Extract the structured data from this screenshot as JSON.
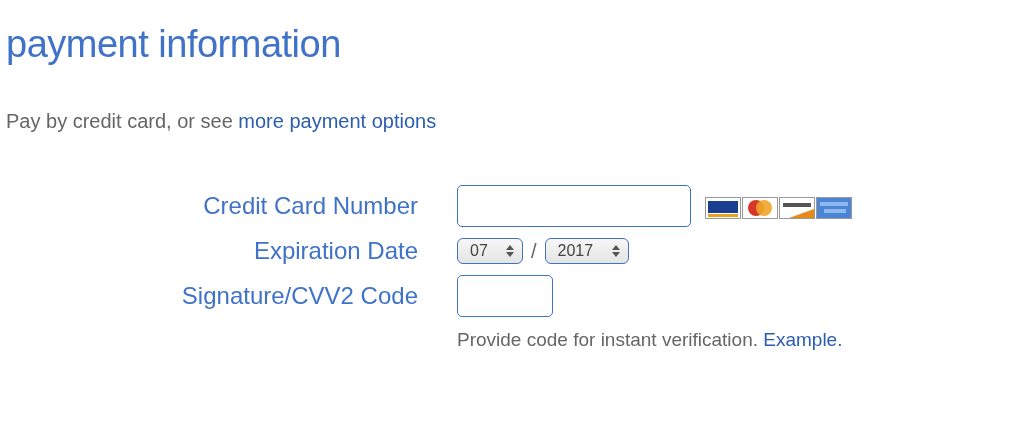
{
  "title": "payment information",
  "intro": {
    "text": "Pay by credit card, or see ",
    "link": "more payment options"
  },
  "fields": [
    {
      "kind": "card_number",
      "label": "Credit Card Number"
    },
    {
      "kind": "date",
      "label": "Expiration Date",
      "month": "07",
      "separator": "/",
      "year": "2017"
    },
    {
      "kind": "cvv",
      "label": "Signature/CVV2 Code",
      "hint": "Provide code for instant verification. ",
      "hint_link": "Example."
    }
  ]
}
